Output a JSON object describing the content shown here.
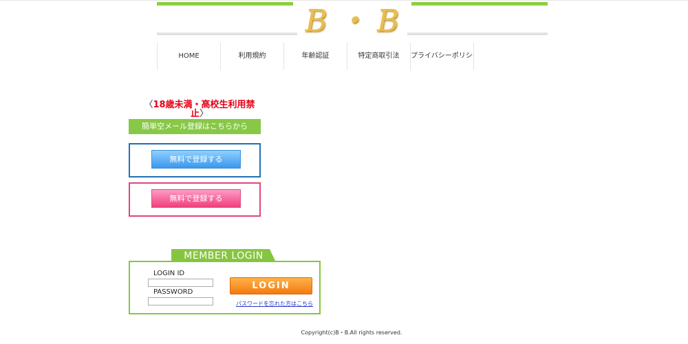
{
  "header": {
    "logo_text": "B ・ B"
  },
  "nav": {
    "items": [
      "HOME",
      "利用規約",
      "年齢認証",
      "特定商取引法",
      "プライバシーポリシー"
    ]
  },
  "warning": {
    "open_bracket": "〈",
    "text": "18歳未満・高校生利用禁止",
    "close_bracket": "〉"
  },
  "register": {
    "banner": "簡単空メール登録はこちらから",
    "blue_button": "無料で登録する",
    "pink_button": "無料で登録する"
  },
  "login": {
    "title": "MEMBER LOGIN",
    "id_label": "LOGIN ID",
    "password_label": "PASSWORD",
    "id_value": "",
    "password_value": "",
    "button": "LOGIN",
    "forgot_link": "パスワードを忘れた方はこちら"
  },
  "footer": {
    "copyright": "Copyright(c)B・B.All rights reserved."
  },
  "colors": {
    "brand_green": "#86c540",
    "warning_red": "#e60012",
    "blue_border": "#1f6fb5",
    "pink_border": "#e0457a",
    "login_orange": "#f37a0f",
    "logo_gold": "#e8be53"
  }
}
